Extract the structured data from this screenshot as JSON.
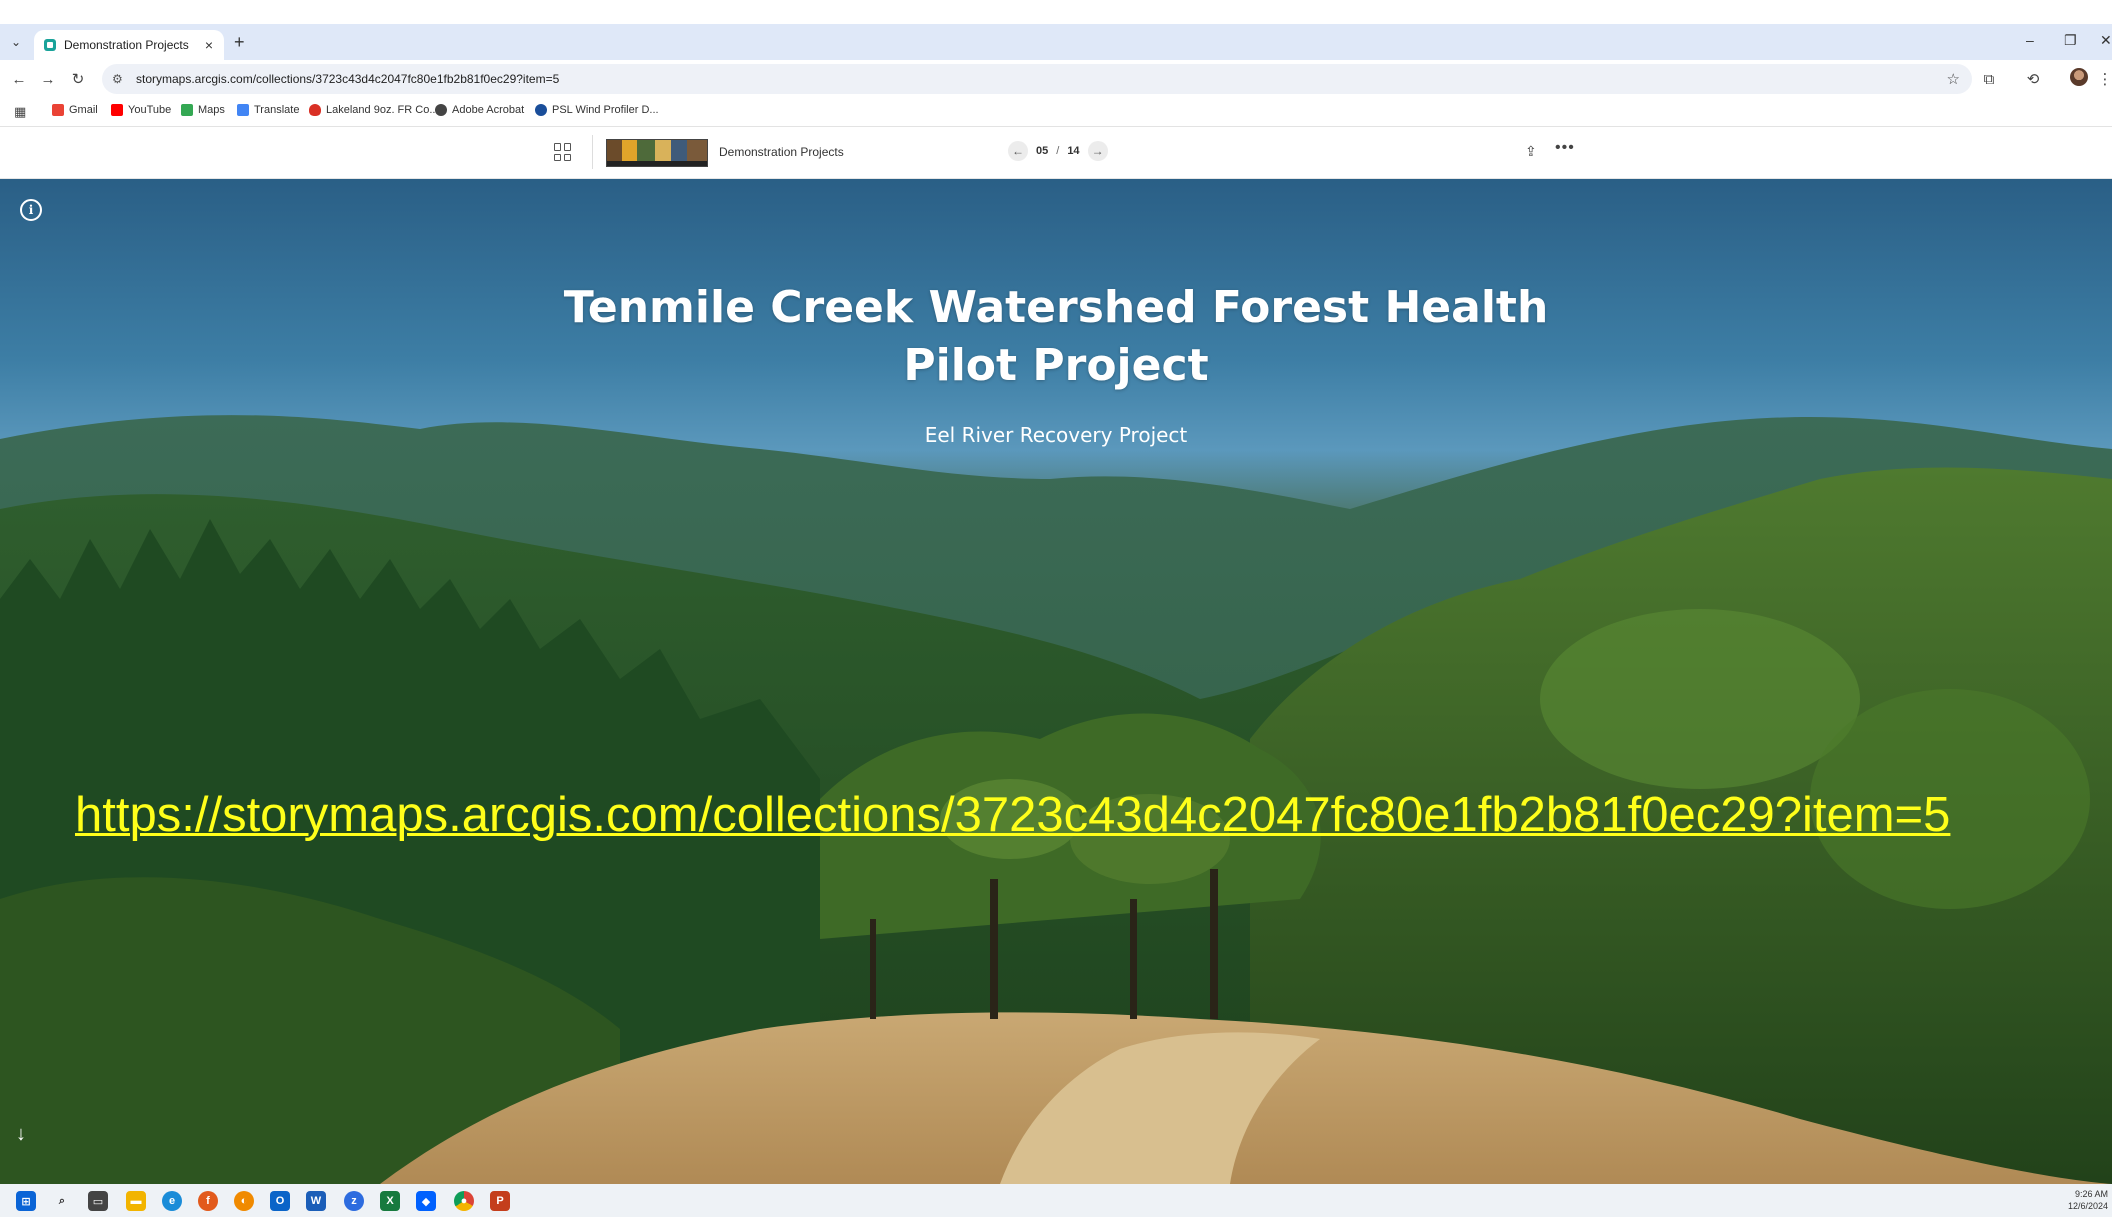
{
  "browser": {
    "tab_title": "Demonstration Projects",
    "tab_close": "×",
    "new_tab": "+",
    "url": "storymaps.arcgis.com/collections/3723c43d4c2047fc80e1fb2b81f0ec29?item=5",
    "window_controls": [
      "–",
      "❐",
      "✕"
    ]
  },
  "bookmarks": [
    {
      "label": "Gmail",
      "color": "#ea4335"
    },
    {
      "label": "YouTube",
      "color": "#ff0000"
    },
    {
      "label": "Maps",
      "color": "#34a853"
    },
    {
      "label": "Translate",
      "color": "#4285f4"
    },
    {
      "label": "Lakeland 9oz. FR Co...",
      "color": "#d93025"
    },
    {
      "label": "Adobe Acrobat",
      "color": "#444444"
    },
    {
      "label": "PSL Wind Profiler D...",
      "color": "#1a4e9a"
    }
  ],
  "storymap": {
    "collection_title": "Demonstration Projects",
    "page_current": "05",
    "page_separator": "/",
    "page_total": "14"
  },
  "hero": {
    "title_line1": "Tenmile Creek Watershed Forest Health",
    "title_line2": "Pilot Project",
    "subtitle": "Eel River Recovery Project",
    "overlay_link": "https://storymaps.arcgis.com/collections/3723c43d4c2047fc80e1fb2b81f0ec29?item=5"
  },
  "taskbar": {
    "time": "9:26 AM",
    "date": "12/6/2024"
  }
}
